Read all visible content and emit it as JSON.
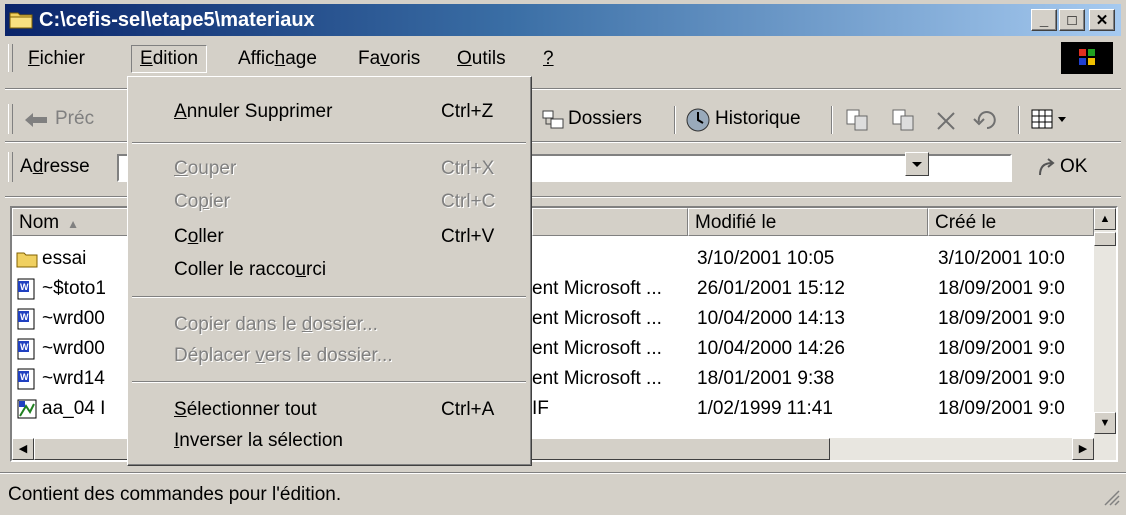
{
  "window": {
    "title": "C:\\cefis-sel\\etape5\\materiaux",
    "minimize": "_",
    "maximize": "□",
    "close": "✕"
  },
  "menubar": {
    "items": [
      {
        "pre": "",
        "key": "F",
        "post": "ichier"
      },
      {
        "pre": "",
        "key": "E",
        "post": "dition"
      },
      {
        "pre": "Affic",
        "key": "h",
        "post": "age"
      },
      {
        "pre": "Fa",
        "key": "v",
        "post": "oris"
      },
      {
        "pre": "",
        "key": "O",
        "post": "utils"
      },
      {
        "pre": "",
        "key": "?",
        "post": ""
      }
    ]
  },
  "toolbar": {
    "back": "Préc",
    "folders": "Dossiers",
    "history": "Historique"
  },
  "address": {
    "label_pre": "A",
    "label_key": "d",
    "label_post": "resse",
    "go": "OK"
  },
  "list": {
    "headers": {
      "name": "Nom",
      "type": "",
      "modified": "Modifié le",
      "created": "Créé le"
    },
    "rows": [
      {
        "icon": "folder",
        "name": "essai",
        "type": "",
        "modified": "3/10/2001 10:05",
        "created": "3/10/2001 10:0"
      },
      {
        "icon": "word",
        "name": "~$toto1",
        "type": "ent Microsoft ...",
        "modified": "26/01/2001 15:12",
        "created": "18/09/2001 9:0"
      },
      {
        "icon": "word",
        "name": "~wrd00",
        "type": "ent Microsoft ...",
        "modified": "10/04/2000 14:13",
        "created": "18/09/2001 9:0"
      },
      {
        "icon": "word",
        "name": "~wrd00",
        "type": "ent Microsoft ...",
        "modified": "10/04/2000 14:26",
        "created": "18/09/2001 9:0"
      },
      {
        "icon": "word",
        "name": "~wrd14",
        "type": "ent Microsoft ...",
        "modified": "18/01/2001 9:38",
        "created": "18/09/2001 9:0"
      },
      {
        "icon": "image",
        "name": "aa_04 I",
        "type": "IF",
        "modified": "1/02/1999 11:41",
        "created": "18/09/2001 9:0"
      }
    ]
  },
  "edit_menu": {
    "items": [
      {
        "pre": "",
        "key": "A",
        "post": "nnuler Supprimer",
        "shortcut": "Ctrl+Z",
        "disabled": false
      },
      {
        "pre": "",
        "key": "C",
        "post": "ouper",
        "shortcut": "Ctrl+X",
        "disabled": true
      },
      {
        "pre": "Co",
        "key": "p",
        "post": "ier",
        "shortcut": "Ctrl+C",
        "disabled": true
      },
      {
        "pre": "C",
        "key": "o",
        "post": "ller",
        "shortcut": "Ctrl+V",
        "disabled": false
      },
      {
        "pre": "Coller le racco",
        "key": "u",
        "post": "rci",
        "shortcut": "",
        "disabled": false
      },
      {
        "pre": "Copier dans le ",
        "key": "d",
        "post": "ossier...",
        "shortcut": "",
        "disabled": true
      },
      {
        "pre": "Déplacer ",
        "key": "v",
        "post": "ers le dossier...",
        "shortcut": "",
        "disabled": true
      },
      {
        "pre": "",
        "key": "S",
        "post": "électionner tout",
        "shortcut": "Ctrl+A",
        "disabled": false
      },
      {
        "pre": "",
        "key": "I",
        "post": "nverser la sélection",
        "shortcut": "",
        "disabled": false
      }
    ]
  },
  "status": {
    "text": "Contient des commandes pour l'édition."
  }
}
